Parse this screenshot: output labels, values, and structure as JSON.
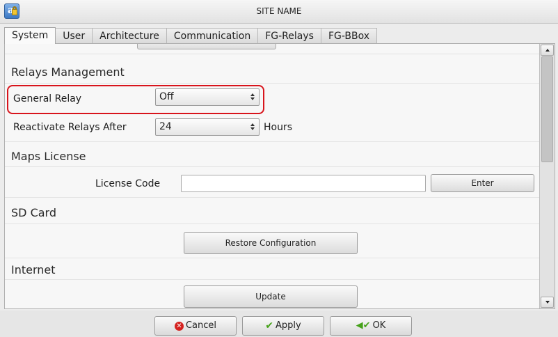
{
  "window": {
    "title": "SITE NAME",
    "app_icon": "app-lock-icon"
  },
  "tabs": [
    {
      "label": "System",
      "active": true
    },
    {
      "label": "User",
      "active": false
    },
    {
      "label": "Architecture",
      "active": false
    },
    {
      "label": "Communication",
      "active": false
    },
    {
      "label": "FG-Relays",
      "active": false
    },
    {
      "label": "FG-BBox",
      "active": false
    }
  ],
  "relays_management": {
    "title": "Relays Management",
    "general_relay": {
      "label": "General Relay",
      "value": "Off"
    },
    "reactivate": {
      "label": "Reactivate Relays After",
      "value": "24",
      "unit": "Hours"
    }
  },
  "maps_license": {
    "title": "Maps License",
    "license_code_label": "License Code",
    "license_code_value": "",
    "enter_label": "Enter"
  },
  "sd_card": {
    "title": "SD Card",
    "restore_label": "Restore Configuration"
  },
  "internet": {
    "title": "Internet",
    "update_label": "Update"
  },
  "footer": {
    "cancel_label": "Cancel",
    "apply_label": "Apply",
    "ok_label": "OK"
  },
  "colors": {
    "highlight": "#d8141c",
    "confirm_icon": "#46a21a",
    "cancel_icon": "#d4211e"
  }
}
